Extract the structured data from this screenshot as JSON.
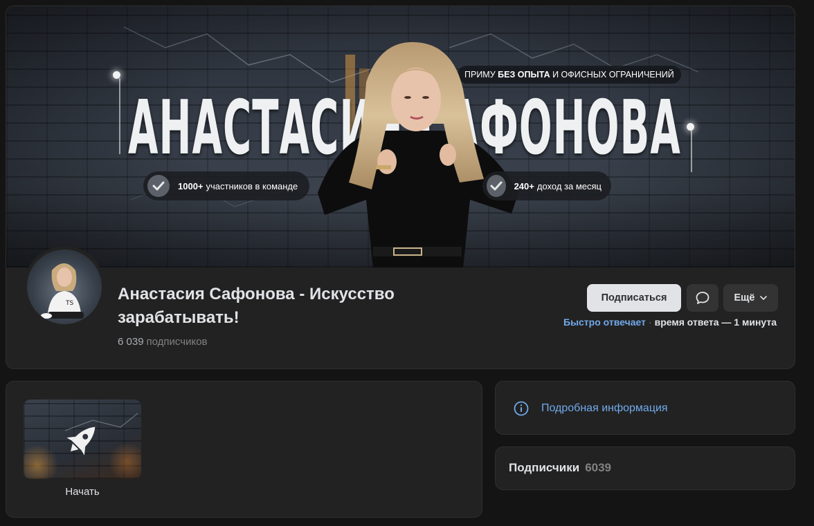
{
  "cover": {
    "title_left": "АНАСТАСИЯ",
    "title_right": "САФОНОВА",
    "tagline_pre": "ПРИМУ",
    "tagline_bold": "БЕЗ ОПЫТА",
    "tagline_post": "И ОФИСНЫХ ОГРАНИЧЕНИЙ",
    "badge_left_bold": "1000+",
    "badge_left_text": "участников в команде",
    "badge_right_bold": "240+",
    "badge_right_text": "доход за месяц"
  },
  "group": {
    "title": "Анастасия Сафонова - Искусство зарабатывать!",
    "subscribers_count": "6 039",
    "subscribers_label": "подписчиков"
  },
  "actions": {
    "subscribe_label": "Подписаться",
    "more_label": "Ещё",
    "reply_fast": "Быстро отвечает",
    "reply_separator": "·",
    "reply_time": "время ответа — 1 минута"
  },
  "links": {
    "app_label": "Начать"
  },
  "info": {
    "details_label": "Подробная информация"
  },
  "subscribers_block": {
    "label": "Подписчики",
    "count": "6039"
  },
  "colors": {
    "background": "#141414",
    "card": "#222222",
    "accent_link": "#71aaeb",
    "primary_button": "#e1e3e6",
    "secondary_button": "#333333"
  }
}
